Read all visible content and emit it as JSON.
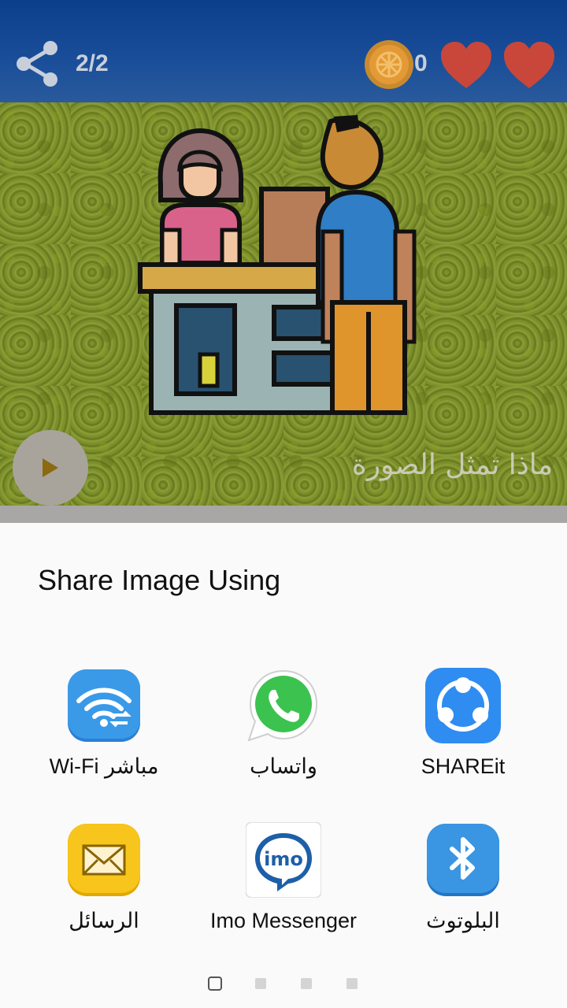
{
  "header": {
    "page_counter": "2/2",
    "coins": "0",
    "colors": {
      "bar": "#1a4e99",
      "heart": "#cc4a3a",
      "coin": "#e08a2c"
    },
    "icons": [
      "share-icon",
      "coin-icon",
      "heart-icon",
      "heart-icon"
    ]
  },
  "image": {
    "caption": "ماذا تمثل الصورة",
    "play_icon": "play-icon"
  },
  "share_sheet": {
    "title": "Share Image Using",
    "apps": [
      {
        "label": "Wi-Fi مباشر",
        "icon": "wifi-direct-icon"
      },
      {
        "label": "واتساب",
        "icon": "whatsapp-icon"
      },
      {
        "label": "SHAREit",
        "icon": "shareit-icon"
      },
      {
        "label": "الرسائل",
        "icon": "messages-icon"
      },
      {
        "label": "Imo Messenger",
        "icon": "imo-icon"
      },
      {
        "label": "البلوتوث",
        "icon": "bluetooth-icon"
      }
    ],
    "pager": {
      "pages": 4,
      "current": 1
    }
  }
}
